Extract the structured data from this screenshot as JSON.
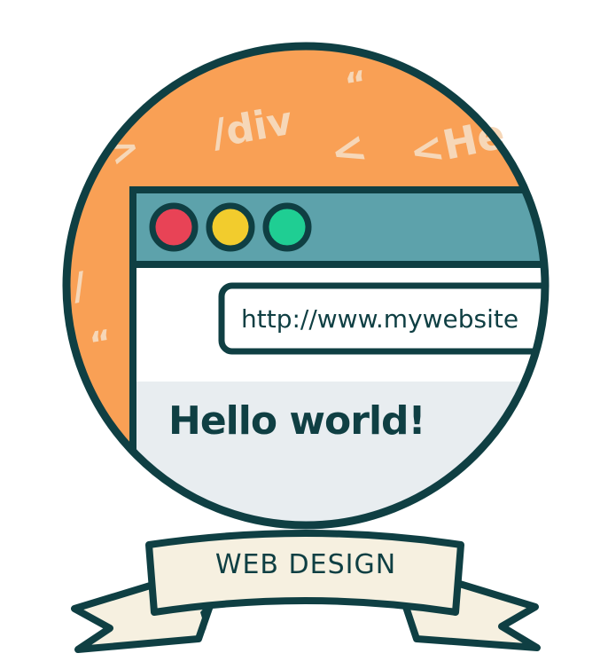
{
  "badge": {
    "decorations": [
      {
        "text": "/div"
      },
      {
        "text": "<He"
      },
      {
        "text": ">"
      },
      {
        "text": "<"
      },
      {
        "text": "“"
      },
      {
        "text": "/"
      },
      {
        "text": "“"
      }
    ],
    "browser": {
      "url": "http://www.mywebsite",
      "heading": "Hello world!"
    },
    "ribbon": {
      "label": "WEB DESIGN"
    }
  },
  "colors": {
    "outline": "#0f3f43",
    "orange": "#f9a055",
    "teal_bar": "#5da2ab",
    "content_bg": "#e8edf0",
    "page_white": "#ffffff",
    "ribbon_fill": "#f6f0e0",
    "btn_red": "#e84356",
    "btn_yellow": "#f2cc2d",
    "btn_green": "#1fce93",
    "deco_text": "#f6d7b8"
  }
}
